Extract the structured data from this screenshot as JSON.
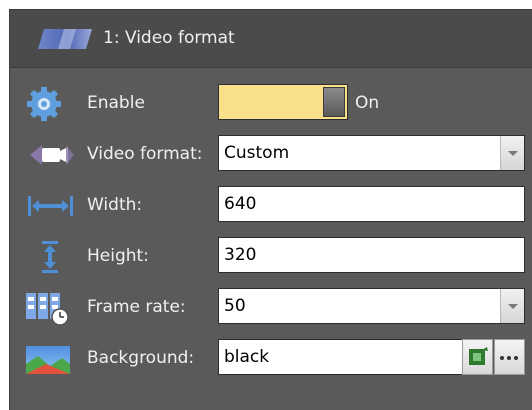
{
  "header": {
    "title": "1: Video format",
    "icon": "video-format-icon"
  },
  "rows": {
    "enable": {
      "label": "Enable",
      "state_label": "On",
      "icon": "gear-icon",
      "on": true
    },
    "video_format": {
      "label": "Video format:",
      "value": "Custom",
      "icon": "video-camera-icon"
    },
    "width": {
      "label": "Width:",
      "value": "640",
      "icon": "width-arrows-icon"
    },
    "height": {
      "label": "Height:",
      "value": "320",
      "icon": "height-arrows-icon"
    },
    "frame_rate": {
      "label": "Frame rate:",
      "value": "50",
      "icon": "frame-rate-icon"
    },
    "background": {
      "label": "Background:",
      "value": "black",
      "icon": "background-image-icon"
    }
  },
  "colors": {
    "panel_bg": "#5a5a5a",
    "header_bg": "#4b4b4b",
    "toggle_on": "#fbe08c",
    "label_text": "#f0f0f0"
  }
}
